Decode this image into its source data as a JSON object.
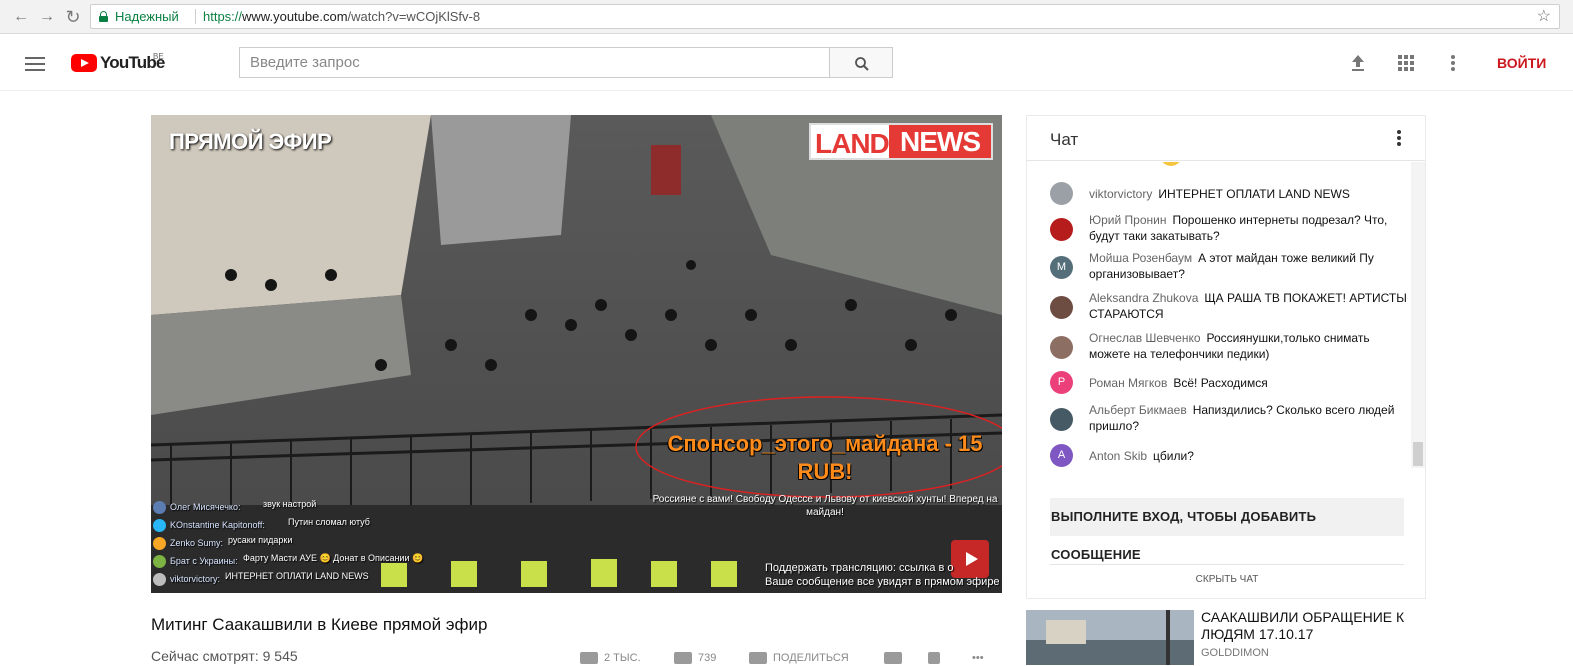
{
  "browser": {
    "secure_label": "Надежный",
    "url_scheme": "https://",
    "url_host": "www.youtube.com",
    "url_path": "/watch?v=wCOjKlSfv-8"
  },
  "header": {
    "logo_text": "YouTube",
    "logo_region": "BE",
    "search_placeholder": "Введите запрос",
    "signin_label": "ВОЙТИ"
  },
  "player": {
    "live_label": "ПРЯМОЙ ЭФИР",
    "brand_left": "LAND",
    "brand_right": "NEWS",
    "sponsor_text": "Спонсор_этого_майдана - 15 RUB!",
    "banner_text": "Россияне с вами! Свободу Одессе и Львову от киевской хунты! Вперед на майдан!",
    "support_line1": "Поддержать трансляцию: ссылка в о",
    "support_line2": "Ваше сообщение все увидят в прямом эфире",
    "overlay_messages": [
      {
        "name": "Олег Мисячечко:",
        "text": "звук настрой"
      },
      {
        "name": "KOnstantine Kapitonoff:",
        "text": "Путин сломал ютуб"
      },
      {
        "name": "Zenko Sumy:",
        "text": "русаки пидарки"
      },
      {
        "name": "Брат с Украины:",
        "text": "Фарту Масти АУЕ 😊 Донат в Описании 😊"
      },
      {
        "name": "viktorvictory:",
        "text": "ИНТЕРНЕТ ОПЛАТИ LAND NEWS"
      }
    ]
  },
  "video": {
    "title": "Митинг Саакашвили в Киеве прямой эфир",
    "views": "Сейчас смотрят: 9 545",
    "likes": "2 ТЫС.",
    "dislikes": "739",
    "share_label": "ПОДЕЛИТЬСЯ"
  },
  "chat": {
    "title": "Чат",
    "messages": [
      {
        "name": "viktorvictory",
        "text": "ИНТЕРНЕТ ОПЛАТИ LAND NEWS",
        "avatar": "",
        "color": "#9aa0a6"
      },
      {
        "name": "Юрий Пронин",
        "text": "Порошенко интернеты подрезал? Что, будут таки закатывать?",
        "avatar": "",
        "color": "#b71c1c"
      },
      {
        "name": "Мойша Розенбаум",
        "text": "А этот майдан тоже великий Пу организовывает?",
        "avatar": "M",
        "color": "#546e7a"
      },
      {
        "name": "Aleksandra Zhukova",
        "text": "ЩА РАША ТВ ПОКАЖЕТ! АРТИСТЫ СТАРАЮТСЯ",
        "avatar": "",
        "color": "#6d4c41"
      },
      {
        "name": "Огнеслав Шевченко",
        "text": "Россиянушки,только снимать можете на телефончики педики)",
        "avatar": "",
        "color": "#8d6e63"
      },
      {
        "name": "Роман Мягков",
        "text": "Всё! Расходимся",
        "avatar": "P",
        "color": "#ec407a"
      },
      {
        "name": "Альберт Бикмаев",
        "text": "Напиздились? Сколько всего людей пришло?",
        "avatar": "",
        "color": "#455a64"
      },
      {
        "name": "Anton Skib",
        "text": "цбили?",
        "avatar": "A",
        "color": "#7e57c2"
      }
    ],
    "signin_prompt": "ВЫПОЛНИТЕ ВХОД, ЧТОБЫ ДОБАВИТЬ СООБЩЕНИЕ",
    "hide_label": "СКРЫТЬ ЧАТ"
  },
  "recommendation": {
    "title": "СААКАШВИЛИ ОБРАЩЕНИЕ К ЛЮДЯМ 17.10.17",
    "channel": "GOLDDIMON"
  }
}
